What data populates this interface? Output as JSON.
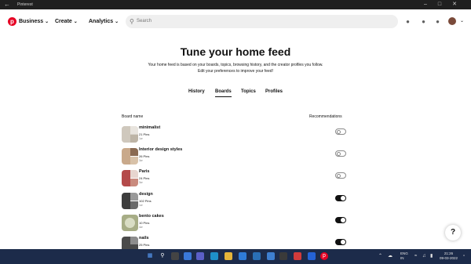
{
  "window": {
    "title": "Pinterest"
  },
  "header": {
    "nav": [
      {
        "label": "Business"
      },
      {
        "label": "Create"
      },
      {
        "label": "Analytics"
      }
    ],
    "search": {
      "placeholder": "Search"
    }
  },
  "main": {
    "title": "Tune your home feed",
    "description_line1": "Your home feed is based on your boards, topics, browsing history, and the creator profiles you follow.",
    "description_line2": "Edit your preferences to improve your feed!",
    "tabs": [
      {
        "label": "History",
        "active": false
      },
      {
        "label": "Boards",
        "active": true
      },
      {
        "label": "Topics",
        "active": false
      },
      {
        "label": "Profiles",
        "active": false
      }
    ],
    "columns": {
      "board_name": "Board name",
      "recommendations": "Recommendations"
    },
    "boards": [
      {
        "name": "minimalist",
        "pins": "21 Pins",
        "age": "1w",
        "recommendations": false
      },
      {
        "name": "Interior design styles",
        "pins": "26 Pins",
        "age": "3w",
        "recommendations": false
      },
      {
        "name": "Paris",
        "pins": "24 Pins",
        "age": "3w",
        "recommendations": false
      },
      {
        "name": "design",
        "pins": "102 Pins",
        "age": "1w",
        "recommendations": true
      },
      {
        "name": "bento cakes",
        "pins": "10 Pins",
        "age": "4w",
        "recommendations": true
      },
      {
        "name": "nails",
        "pins": "25 Pins",
        "age": "",
        "recommendations": true
      }
    ]
  },
  "taskbar": {
    "lang_line1": "ENG",
    "lang_line2": "IN",
    "time": "21:26",
    "date": "09-03-2022"
  },
  "colors": {
    "brand": "#e60023",
    "taskbar": "#1c2b4a",
    "toggle_on": "#111111"
  }
}
